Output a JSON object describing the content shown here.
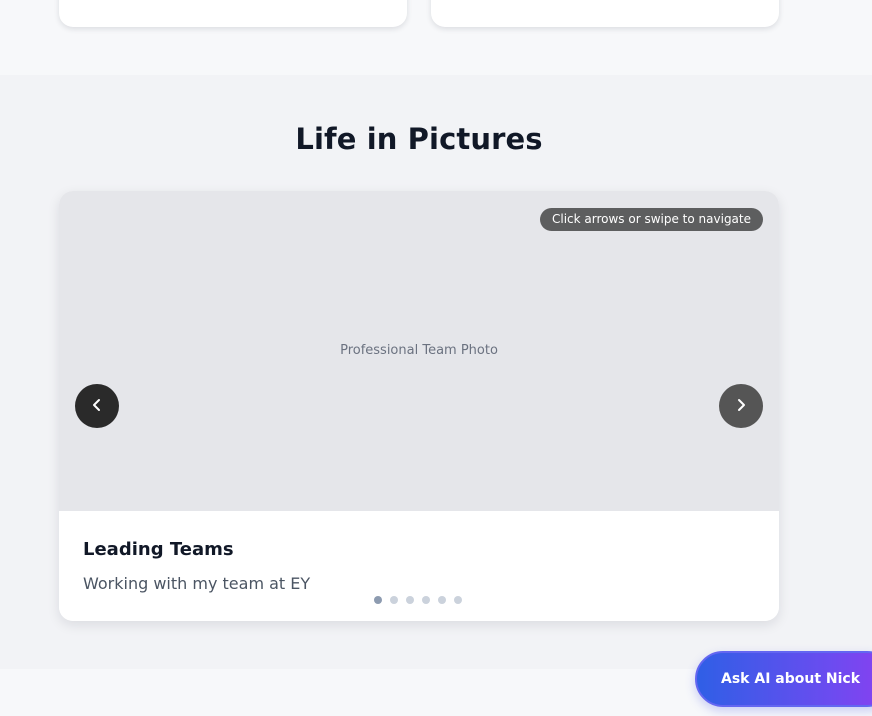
{
  "gallery": {
    "title": "Life in Pictures",
    "hint": "Click arrows or swipe to navigate",
    "photo_placeholder": "Professional Team Photo",
    "slide": {
      "title": "Leading Teams",
      "caption": "Working with my team at EY"
    },
    "slide_count": 6,
    "active_index": 0,
    "prev_icon": "chevron-left-icon",
    "next_icon": "chevron-right-icon"
  },
  "ask_ai": {
    "label": "Ask AI about Nick",
    "icon": "chat-bubble-icon"
  },
  "colors": {
    "section_bg": "#f2f3f6",
    "photo_bg": "#e5e6ea",
    "title_text": "#111827",
    "dot_active": "#8d9bb0",
    "dot_inactive": "#cbd2dc",
    "ask_ai_gradient_start": "#2f5fe6",
    "ask_ai_gradient_end": "#8b3ff0"
  }
}
